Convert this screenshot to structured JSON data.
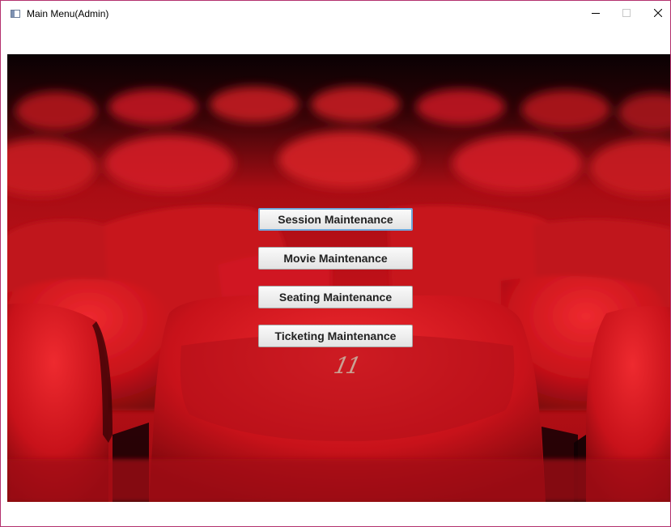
{
  "window": {
    "title": "Main Menu(Admin)",
    "controls": [
      "minimize-icon",
      "maximize-icon",
      "close-icon"
    ]
  },
  "menu": {
    "buttons": [
      {
        "label": "Session Maintenance",
        "focused": true
      },
      {
        "label": "Movie Maintenance",
        "focused": false
      },
      {
        "label": "Seating Maintenance",
        "focused": false
      },
      {
        "label": "Ticketing Maintenance",
        "focused": false
      }
    ]
  },
  "background": {
    "seat_number": "11",
    "colors": {
      "seat_red": "#d4141c",
      "dark_red": "#5e0508",
      "shadow": "#1a0204"
    }
  },
  "colors": {
    "window_border": "#b4326e",
    "focus_border": "#6fa8dc"
  }
}
